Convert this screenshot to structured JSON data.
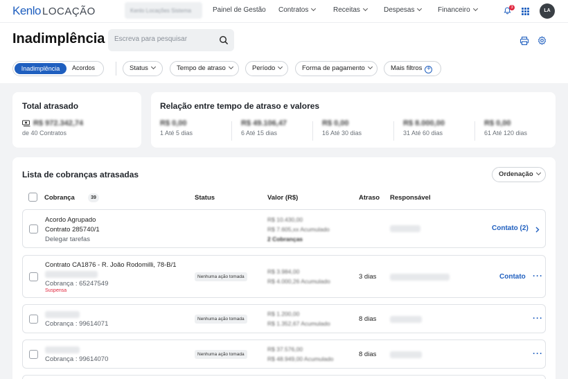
{
  "topbar": {
    "logo_main": "Kenlo",
    "logo_sub": "LOCAÇÃO",
    "company": "Kenlo Locações Sistema",
    "nav": [
      {
        "label": "Painel de Gestão"
      },
      {
        "label": "Contratos"
      },
      {
        "label": "Receitas"
      },
      {
        "label": "Despesas"
      },
      {
        "label": "Financeiro"
      }
    ],
    "notification_count": "3",
    "avatar": "LA"
  },
  "header": {
    "title": "Inadimplência",
    "search_placeholder": "Escreva para pesquisar",
    "segments": [
      "Inadimplência",
      "Acordos"
    ],
    "filters": [
      "Status",
      "Tempo de atraso",
      "Período",
      "Forma de pagamento",
      "Mais filtros"
    ]
  },
  "summary": {
    "title": "Total atrasado",
    "value": "R$ 972.342,74",
    "subtitle": "de 40 Contratos"
  },
  "relation": {
    "title": "Relação entre tempo de atraso e valores",
    "buckets": [
      {
        "value": "R$ 0,00",
        "label": "1 Até 5 dias"
      },
      {
        "value": "R$ 49.106,47",
        "label": "6 Até 15 dias"
      },
      {
        "value": "R$ 0,00",
        "label": "16 Até 30 dias"
      },
      {
        "value": "R$ 8.000,00",
        "label": "31 Até 60 dias"
      },
      {
        "value": "R$ 0,00",
        "label": "61 Até 120 dias"
      }
    ]
  },
  "list": {
    "title": "Lista de cobranças atrasadas",
    "sort_label": "Ordenação",
    "columns": [
      "Cobrança",
      "Status",
      "Valor (R$)",
      "Atraso",
      "Responsável"
    ],
    "count": "39",
    "rows": [
      {
        "line1": "Acordo Agrupado",
        "line2": "Contrato 285740/1",
        "line3": "Delegar tarefas",
        "status": "",
        "value": "R$ 10.430,00",
        "accumulated": "R$ 7.605,xx Acumulado",
        "extra": "2 Cobranças",
        "delay": "",
        "action": "Contato (2)"
      },
      {
        "line1": "Contrato CA1876 - R. João Rodomilli, 78-B/1",
        "line2": "Cobrança : 65247549",
        "flag": "Suspensa",
        "status": "Nenhuma ação tomada",
        "value": "R$ 3.984,00",
        "accumulated": "R$ 4.000,26 Acumulado",
        "delay": "3 dias",
        "action": "Contato"
      },
      {
        "line2": "Cobrança : 99614071",
        "status": "Nenhuma ação tomada",
        "value": "R$ 1.200,00",
        "accumulated": "R$ 1.352,67 Acumulado",
        "delay": "8 dias"
      },
      {
        "line2": "Cobrança : 99614070",
        "status": "Nenhuma ação tomada",
        "value": "R$ 37.576,00",
        "accumulated": "R$ 48.949,00 Acumulado",
        "delay": "8 dias"
      }
    ]
  }
}
